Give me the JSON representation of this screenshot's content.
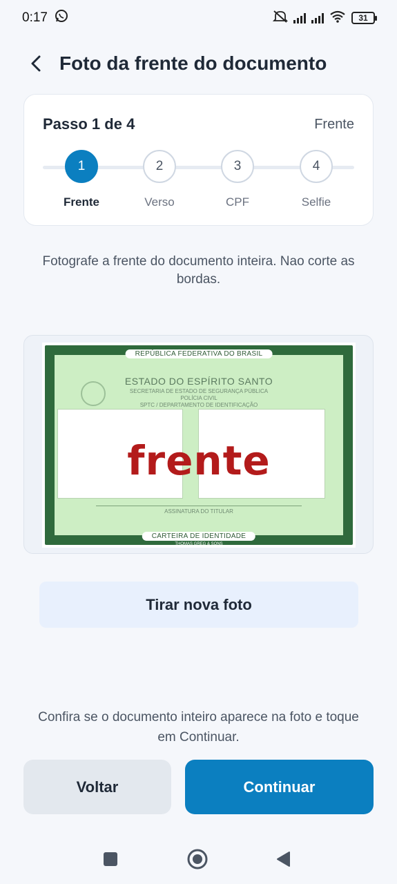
{
  "status_bar": {
    "time": "0:17",
    "battery": "31",
    "icons": [
      "whatsapp-icon",
      "mute-icon",
      "signal-icon",
      "signal-icon",
      "wifi-icon",
      "battery-icon"
    ]
  },
  "header": {
    "title": "Foto da frente do documento"
  },
  "stepper": {
    "step_count": "Passo 1 de 4",
    "current_label": "Frente",
    "steps": [
      {
        "number": "1",
        "label": "Frente",
        "active": true
      },
      {
        "number": "2",
        "label": "Verso",
        "active": false
      },
      {
        "number": "3",
        "label": "CPF",
        "active": false
      },
      {
        "number": "4",
        "label": "Selfie",
        "active": false
      }
    ]
  },
  "instruction": "Fotografe a frente do documento inteira. Nao corte as bordas.",
  "document": {
    "banner_top": "REPÚBLICA FEDERATIVA DO BRASIL",
    "state": "ESTADO DO ESPÍRITO SANTO",
    "line1": "SECRETARIA DE ESTADO DE SEGURANÇA PÚBLICA",
    "line2": "POLÍCIA CIVIL",
    "line3": "SPTC / DEPARTAMENTO DE IDENTIFICAÇÃO",
    "overlay_word": "frente",
    "signature_label": "ASSINATURA DO TITULAR",
    "banner_bottom": "CARTEIRA DE IDENTIDADE",
    "maker": "THOMAS GREG & SONS"
  },
  "retake_button": "Tirar nova foto",
  "confirm_text": "Confira se o documento inteiro aparece na foto e toque em Continuar.",
  "actions": {
    "back": "Voltar",
    "continue": "Continuar"
  },
  "colors": {
    "primary": "#0b7fc0",
    "background": "#f5f7fb",
    "retake_bg": "#e8f0fd",
    "back_bg": "#e3e8ee"
  }
}
